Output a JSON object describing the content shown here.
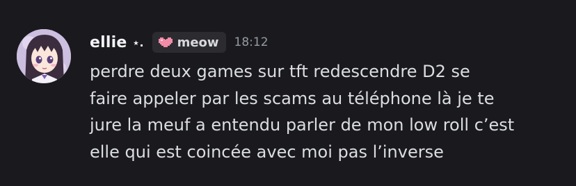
{
  "message": {
    "author": {
      "username": "ellie",
      "name_decoration": "⋆.",
      "avatar_icon": "anime-girl-avatar"
    },
    "tag": {
      "icon": "pink-heart-icon",
      "label": "meow"
    },
    "timestamp": "18:12",
    "content_lines": [
      "perdre deux games sur tft redescendre D2 se",
      "faire appeler par les scams au téléphone là je te",
      "jure la meuf a entendu parler de mon low roll c’est",
      "elle qui est coincée avec moi pas l’inverse"
    ]
  },
  "colors": {
    "background": "#1a1a1e",
    "username": "#f2f3f5",
    "text": "#dbdee1",
    "timestamp": "#949ba4",
    "tag_background": "#2b2b30",
    "heart": "#f28ca6"
  }
}
